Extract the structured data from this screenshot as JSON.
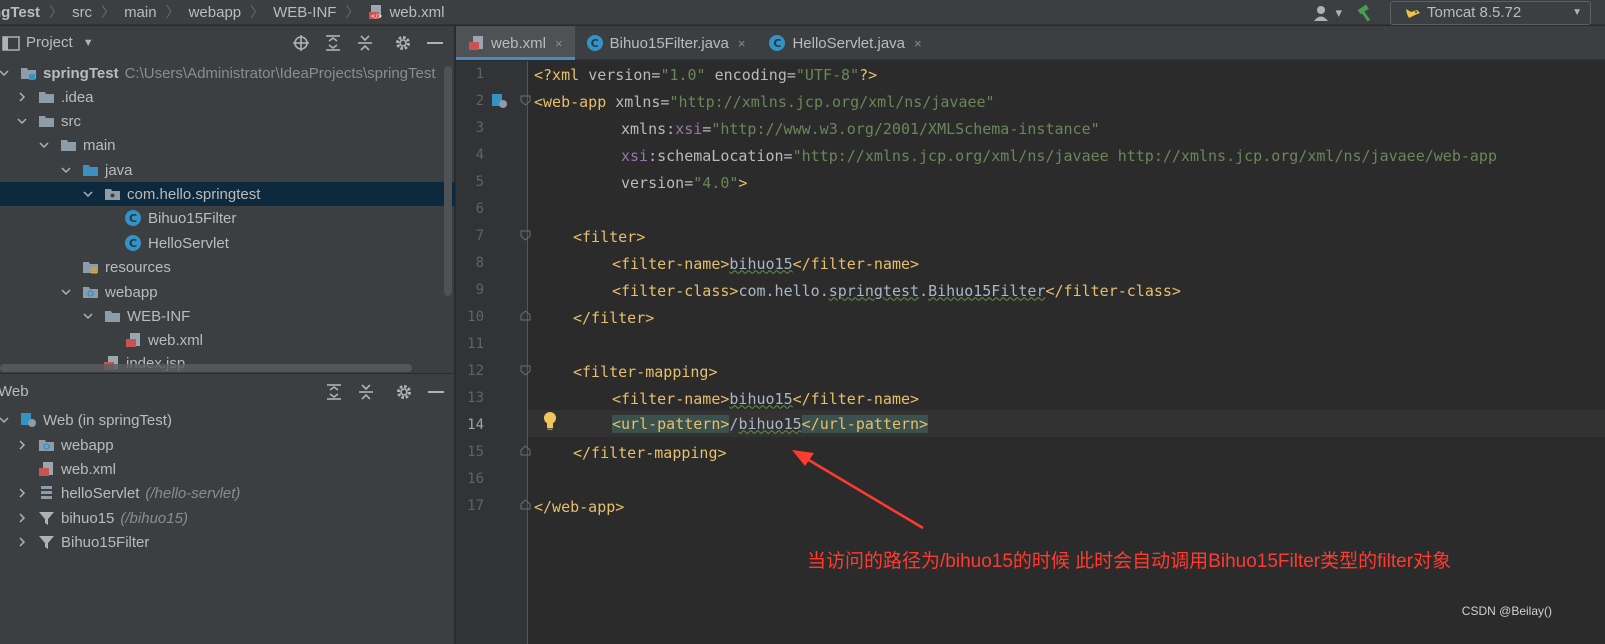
{
  "breadcrumb": {
    "items": [
      "ngTest",
      "src",
      "main",
      "webapp",
      "WEB-INF",
      "web.xml"
    ]
  },
  "toolbar": {
    "run_config": "Tomcat 8.5.72"
  },
  "project_panel": {
    "title": "Project",
    "tree": [
      {
        "label": "springTest",
        "extra": "C:\\Users\\Administrator\\IdeaProjects\\springTest"
      },
      {
        "label": ".idea"
      },
      {
        "label": "src"
      },
      {
        "label": "main"
      },
      {
        "label": "java"
      },
      {
        "label": "com.hello.springtest"
      },
      {
        "label": "Bihuo15Filter"
      },
      {
        "label": "HelloServlet"
      },
      {
        "label": "resources"
      },
      {
        "label": "webapp"
      },
      {
        "label": "WEB-INF"
      },
      {
        "label": "web.xml"
      },
      {
        "label": "index.jsp"
      }
    ]
  },
  "web_panel": {
    "title": "Web",
    "tree": [
      {
        "label": "Web (in springTest)"
      },
      {
        "label": "webapp"
      },
      {
        "label": "web.xml"
      },
      {
        "label": "helloServlet",
        "extra": "(/hello-servlet)"
      },
      {
        "label": "bihuo15",
        "extra": "(/bihuo15)"
      },
      {
        "label": "Bihuo15Filter"
      }
    ]
  },
  "tabs": [
    {
      "label": "web.xml",
      "close": "×"
    },
    {
      "label": "Bihuo15Filter.java",
      "close": "×"
    },
    {
      "label": "HelloServlet.java",
      "close": "×"
    }
  ],
  "editor": {
    "line_numbers": [
      "1",
      "2",
      "3",
      "4",
      "5",
      "6",
      "7",
      "8",
      "9",
      "10",
      "11",
      "12",
      "13",
      "14",
      "15",
      "16",
      "17"
    ],
    "code": {
      "l1_pi_open": "<?xml ",
      "l1_version": "version=",
      "l1_version_val": "\"1.0\"",
      "l1_encoding": " encoding=",
      "l1_encoding_val": "\"UTF-8\"",
      "l1_pi_close": "?>",
      "l2_tag": "<web-app ",
      "l2_attr": "xmlns=",
      "l2_val": "\"http://xmlns.jcp.org/xml/ns/javaee\"",
      "l3_ns": "xmlns:",
      "l3_attr": "xsi",
      "l3_eq": "=",
      "l3_val": "\"http://www.w3.org/2001/XMLSchema-instance\"",
      "l4_ns": "xsi",
      "l4_attr": ":schemaLocation=",
      "l4_val": "\"http://xmlns.jcp.org/xml/ns/javaee http://xmlns.jcp.org/xml/ns/javaee/web-app",
      "l5_attr": "version=",
      "l5_val": "\"4.0\"",
      "l5_close": ">",
      "l7": "<filter>",
      "l8_open": "<filter-name>",
      "l8_text": "bihuo15",
      "l8_close": "</filter-name>",
      "l9_open": "<filter-class>",
      "l9_text_a": "com.hello.",
      "l9_text_b": "springtest",
      "l9_text_c": ".",
      "l9_text_d": "Bihuo15Filter",
      "l9_close": "</filter-class>",
      "l10": "</filter>",
      "l12": "<filter-mapping>",
      "l13_open": "<filter-name>",
      "l13_text": "bihuo15",
      "l13_close": "</filter-name>",
      "l14_open": "<url-pattern>",
      "l14_text_a": "/",
      "l14_text_b": "bihuo15",
      "l14_close": "</url-pattern>",
      "l15": "</filter-mapping>",
      "l17": "</web-app>"
    }
  },
  "annotation": "当访问的路径为/bihuo15的时候 此时会自动调用Bihuo15Filter类型的filter对象",
  "watermark": "CSDN @Beilay()",
  "colors": {
    "annotation": "#ff3b30",
    "tag": "#e8bf6a",
    "string": "#6a8759",
    "selection": "#0d293e"
  }
}
